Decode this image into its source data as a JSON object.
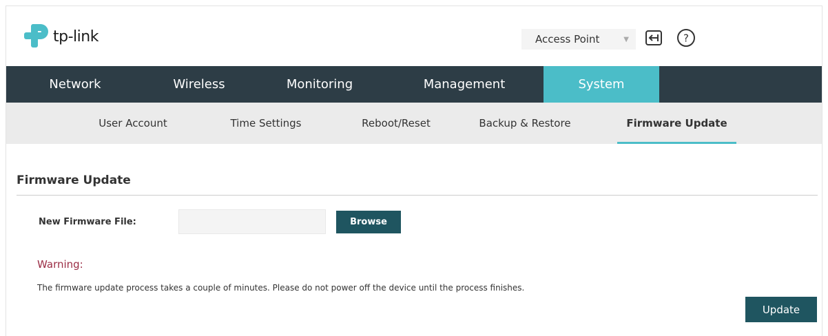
{
  "brand": {
    "name": "tp-link",
    "logo_color": "#4bbdc8"
  },
  "header": {
    "mode_select": {
      "selected": "Access Point"
    },
    "icons": [
      "logout-icon",
      "help-icon"
    ]
  },
  "main_nav": {
    "tabs": [
      {
        "label": "Network"
      },
      {
        "label": "Wireless"
      },
      {
        "label": "Monitoring"
      },
      {
        "label": "Management"
      },
      {
        "label": "System"
      }
    ],
    "active": "System",
    "active_color": "#4bbdc8",
    "bar_color": "#2d3d46"
  },
  "sub_nav": {
    "items": [
      {
        "label": "User Account"
      },
      {
        "label": "Time Settings"
      },
      {
        "label": "Reboot/Reset"
      },
      {
        "label": "Backup & Restore"
      },
      {
        "label": "Firmware Update"
      }
    ],
    "active": "Firmware Update"
  },
  "content": {
    "section_title": "Firmware Update",
    "file_label": "New Firmware File:",
    "file_value": "",
    "browse_label": "Browse",
    "warning_title": "Warning:",
    "warning_text": "The firmware update process takes a couple of minutes. Please do not power off the device until the process finishes.",
    "update_label": "Update",
    "button_color": "#1f5560",
    "warning_color": "#9b2d45"
  }
}
